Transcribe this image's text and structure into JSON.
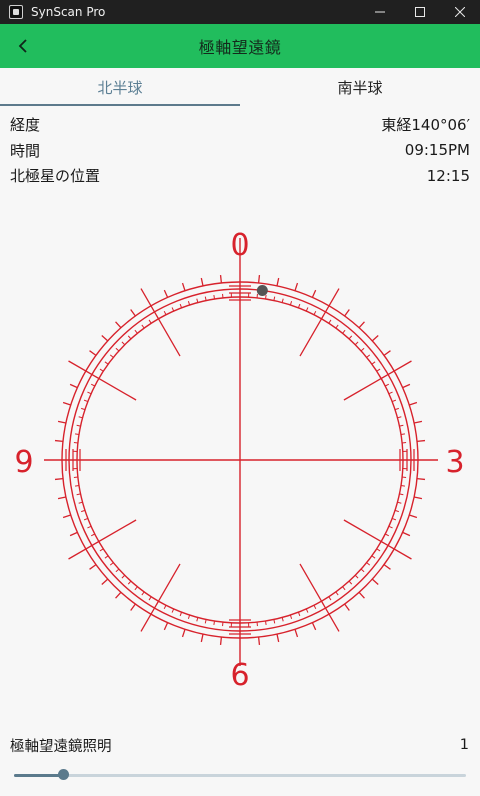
{
  "window": {
    "title": "SynScan Pro"
  },
  "header": {
    "title": "極軸望遠鏡"
  },
  "tabs": [
    {
      "label": "北半球",
      "selected": true
    },
    {
      "label": "南半球",
      "selected": false
    }
  ],
  "info": {
    "longitude_label": "経度",
    "longitude_value": "東経140°06′",
    "time_label": "時間",
    "time_value": "09:15PM",
    "polaris_label": "北極星の位置",
    "polaris_value": "12:15"
  },
  "reticle": {
    "labels": {
      "top": "0",
      "right": "3",
      "bottom": "6",
      "left": "9"
    },
    "polaris_clock_position": "12:15",
    "color": "#d7222c"
  },
  "illumination": {
    "label": "極軸望遠鏡照明",
    "value": "1",
    "slider_fraction": 0.11
  },
  "colors": {
    "accent_green": "#21bd5d",
    "tab_accent": "#5c7f94",
    "reticle_red": "#d7222c"
  }
}
